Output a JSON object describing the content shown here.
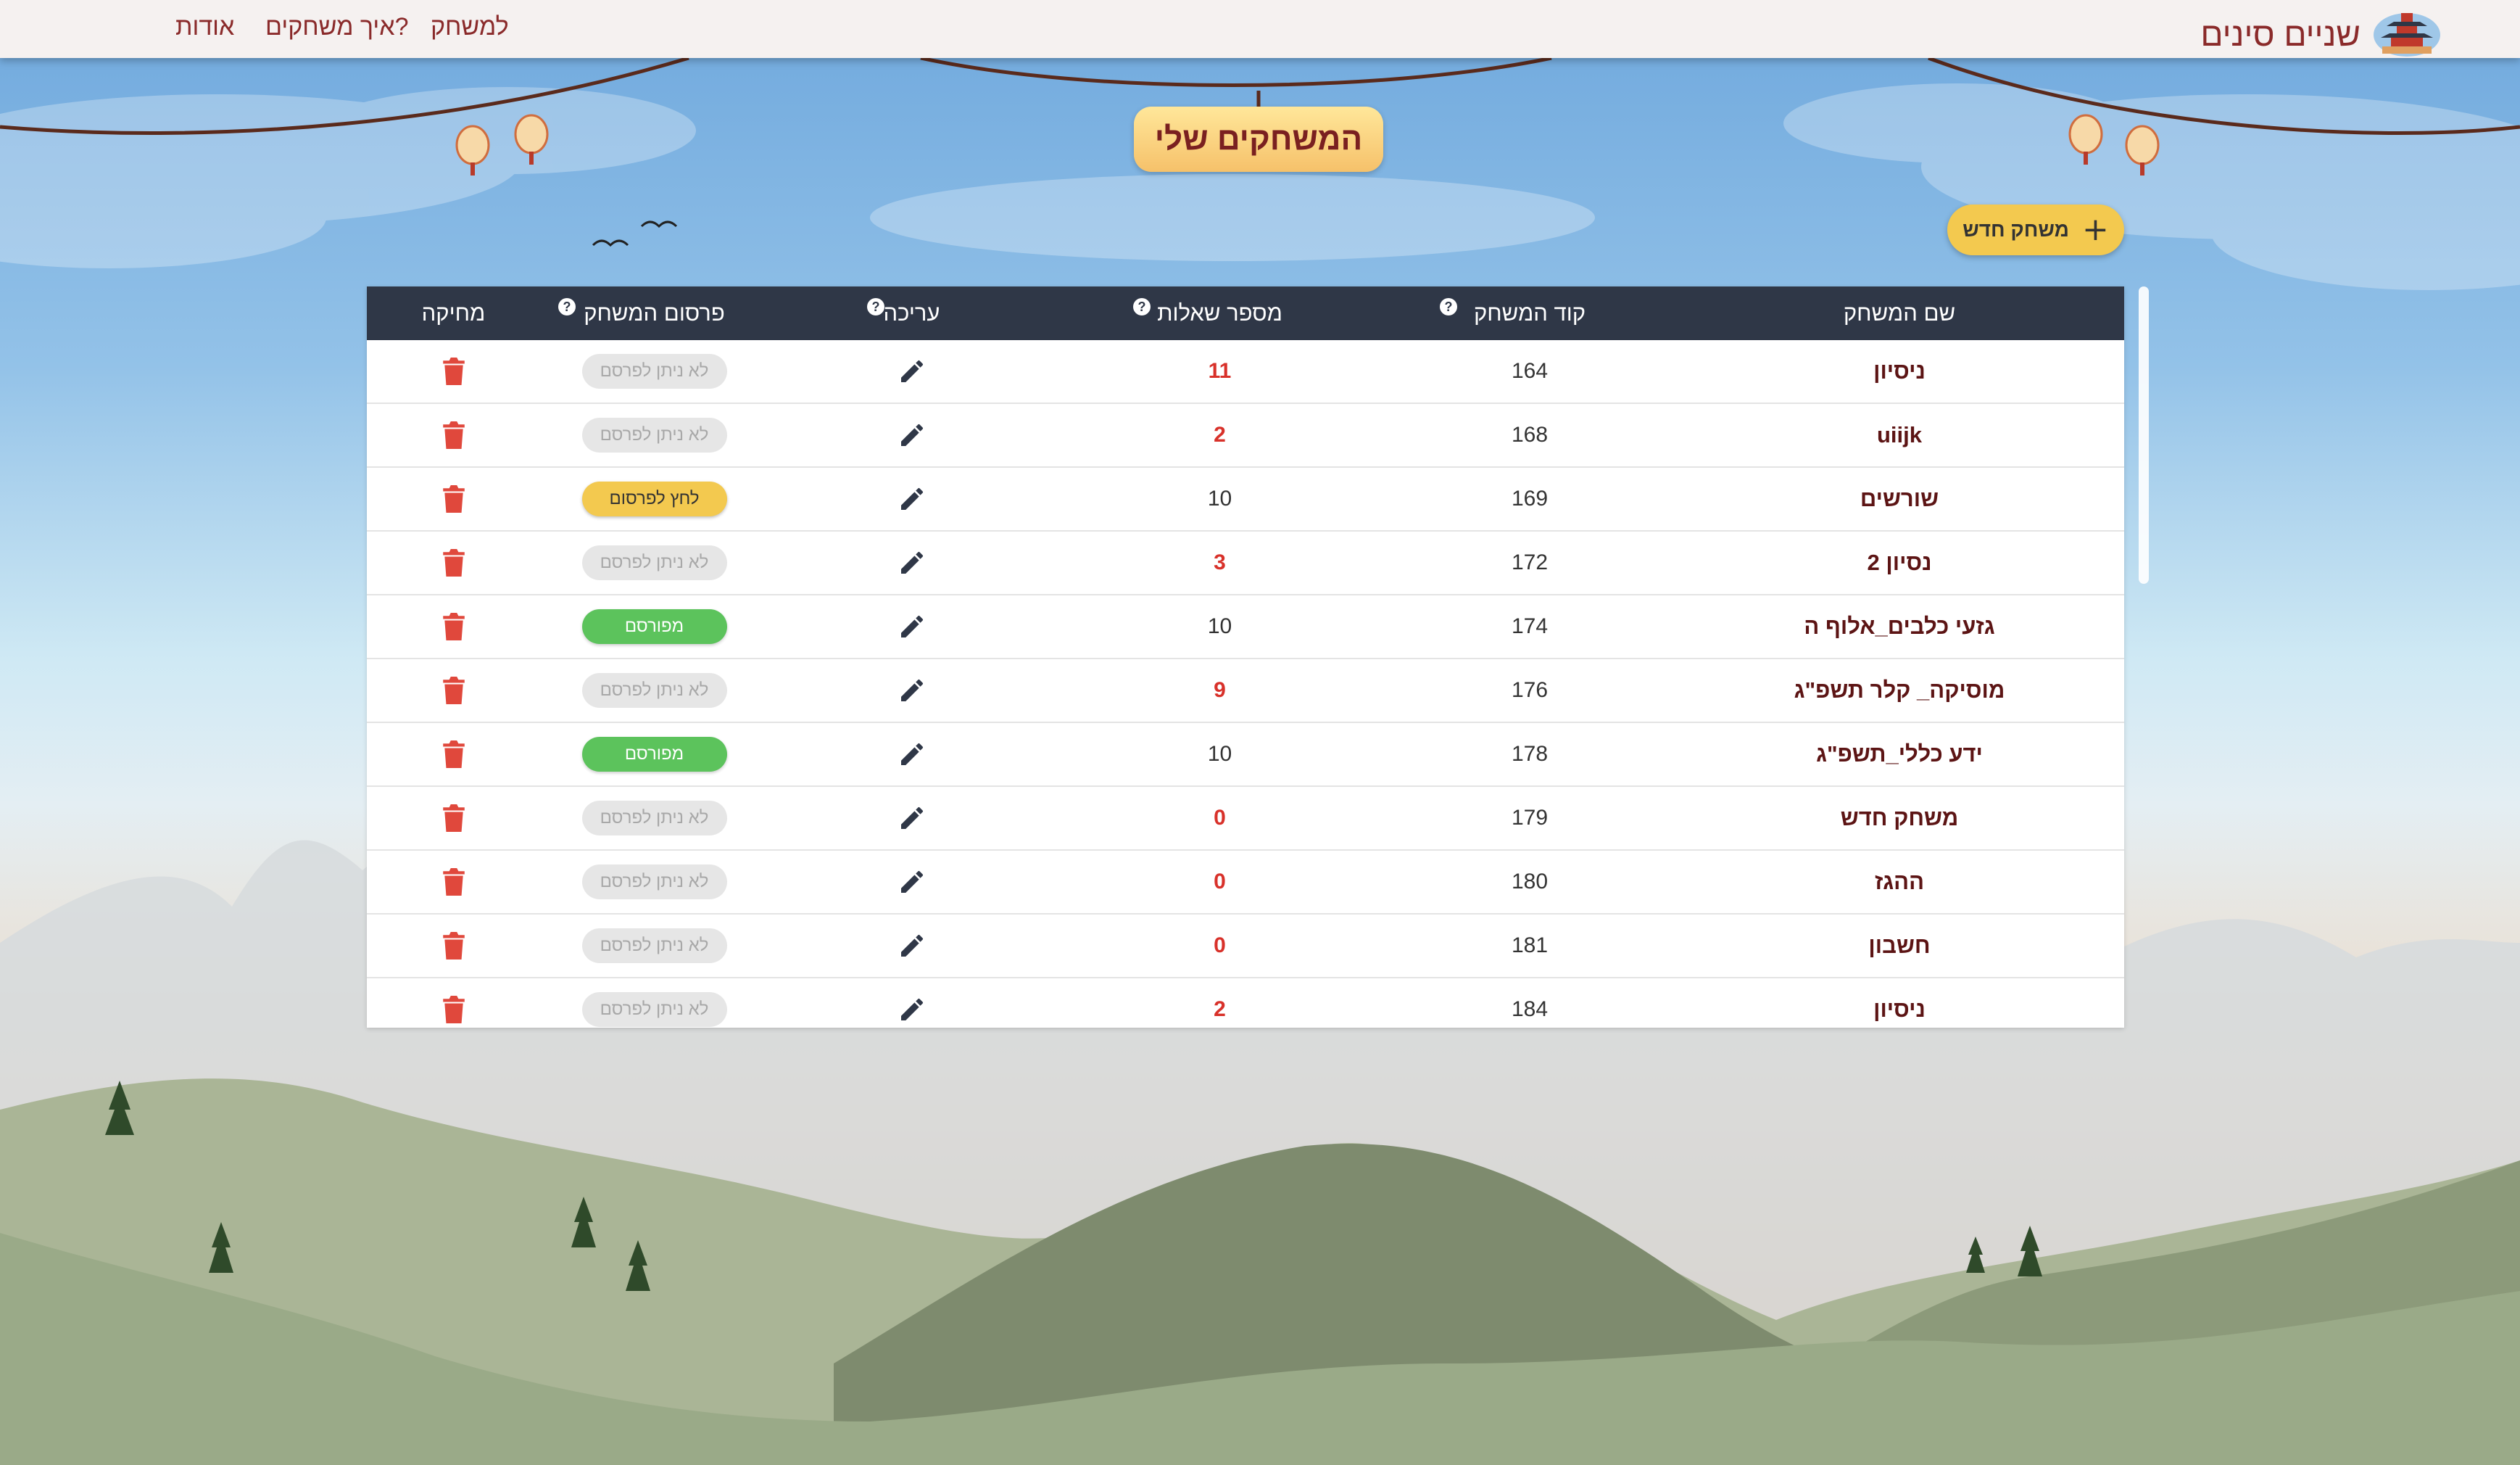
{
  "nav": {
    "brand_title": "שניים סינים",
    "brand_logo_icon": "temple-icon",
    "links": {
      "game": "למשחק",
      "how": "איך משחקים?",
      "about": "אודות"
    }
  },
  "page": {
    "title": "המשחקים שלי",
    "new_game_label": "משחק חדש",
    "new_game_icon": "plus-icon"
  },
  "table": {
    "headers": {
      "name": "שם המשחק",
      "code": "קוד המשחק",
      "questions": "מספר שאלות",
      "edit": "עריכה",
      "publish": "פרסום המשחק",
      "delete": "מחיקה"
    },
    "help_icon_text": "?",
    "rows": [
      {
        "name": "ניסיון",
        "code": "164",
        "questions": "11",
        "questions_warn": true,
        "publish_state": "disabled",
        "publish_label": "לא ניתן לפרסם"
      },
      {
        "name": "uiijk",
        "code": "168",
        "questions": "2",
        "questions_warn": true,
        "publish_state": "disabled",
        "publish_label": "לא ניתן לפרסם"
      },
      {
        "name": "שורשים",
        "code": "169",
        "questions": "10",
        "questions_warn": false,
        "publish_state": "click",
        "publish_label": "לחץ לפרסום"
      },
      {
        "name": "נסיון 2",
        "code": "172",
        "questions": "3",
        "questions_warn": true,
        "publish_state": "disabled",
        "publish_label": "לא ניתן לפרסם"
      },
      {
        "name": "גזעי כלבים_אלוף ה",
        "code": "174",
        "questions": "10",
        "questions_warn": false,
        "publish_state": "published",
        "publish_label": "מפורסם"
      },
      {
        "name": "מוסיקה_ קלר תשפ\"ג",
        "code": "176",
        "questions": "9",
        "questions_warn": true,
        "publish_state": "disabled",
        "publish_label": "לא ניתן לפרסם"
      },
      {
        "name": "ידע כללי_תשפ\"ג",
        "code": "178",
        "questions": "10",
        "questions_warn": false,
        "publish_state": "published",
        "publish_label": "מפורסם"
      },
      {
        "name": "משחק חדש",
        "code": "179",
        "questions": "0",
        "questions_warn": true,
        "publish_state": "disabled",
        "publish_label": "לא ניתן לפרסם"
      },
      {
        "name": "ההגז",
        "code": "180",
        "questions": "0",
        "questions_warn": true,
        "publish_state": "disabled",
        "publish_label": "לא ניתן לפרסם"
      },
      {
        "name": "חשבון",
        "code": "181",
        "questions": "0",
        "questions_warn": true,
        "publish_state": "disabled",
        "publish_label": "לא ניתן לפרסם"
      },
      {
        "name": "ניסיון",
        "code": "184",
        "questions": "2",
        "questions_warn": true,
        "publish_state": "disabled",
        "publish_label": "לא ניתן לפרסם"
      }
    ]
  },
  "colors": {
    "header_bg": "#2f3747",
    "accent_yellow": "#f3c94f",
    "published_green": "#5cc35c",
    "warn_red": "#d8312a",
    "name_color": "#5c1414",
    "brand_color": "#8a2a2a"
  }
}
